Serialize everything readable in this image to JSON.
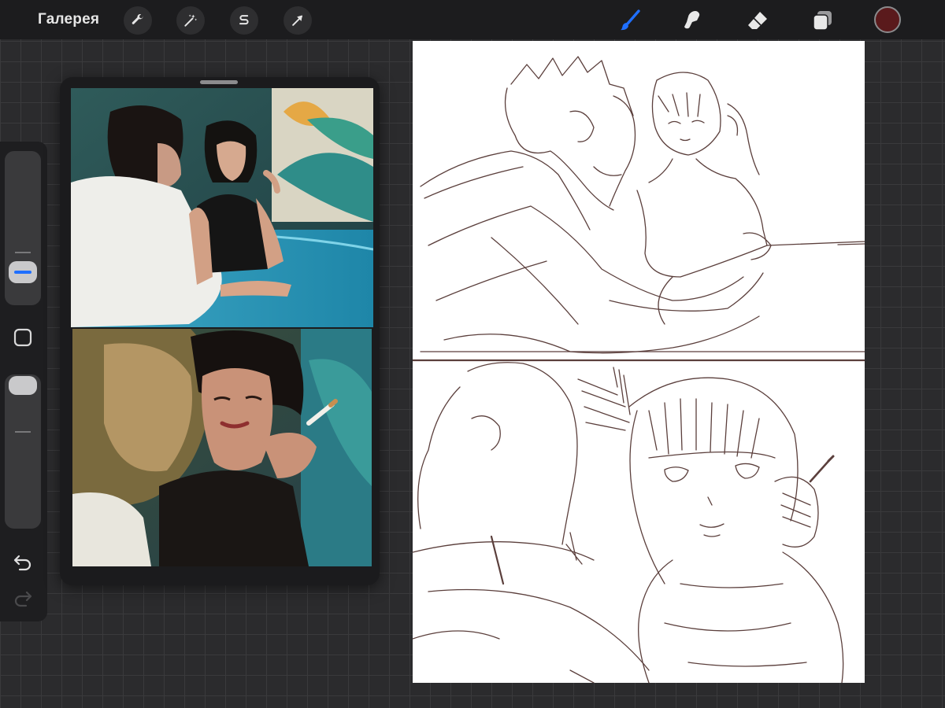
{
  "toolbar": {
    "gallery_label": "Галерея",
    "left_tools": [
      {
        "name": "actions",
        "icon": "wrench-icon"
      },
      {
        "name": "adjustments",
        "icon": "magic-wand-icon"
      },
      {
        "name": "selection",
        "icon": "selection-s-icon"
      },
      {
        "name": "transform",
        "icon": "arrow-cursor-icon"
      }
    ],
    "right_tools": [
      {
        "name": "brush",
        "icon": "brush-icon",
        "active": true
      },
      {
        "name": "smudge",
        "icon": "smudge-icon",
        "active": false
      },
      {
        "name": "eraser",
        "icon": "eraser-icon",
        "active": false
      },
      {
        "name": "layers",
        "icon": "layers-icon",
        "active": false
      }
    ],
    "current_color": "#5a1a1c",
    "active_color": "#1f6fff",
    "inactive_color": "#e8e8e8"
  },
  "sidebar": {
    "size_slider": {
      "icon": "size-slider"
    },
    "modify_button": {
      "icon": "square-modify-icon"
    },
    "opacity_slider": {
      "icon": "opacity-slider",
      "level": 1.0
    },
    "undo": {
      "icon": "undo-icon",
      "enabled": true
    },
    "redo": {
      "icon": "redo-icon",
      "enabled": false
    }
  },
  "reference_window": {
    "photos": [
      {
        "icon": "reference-photo-couple-at-table"
      },
      {
        "icon": "reference-photo-closeup-woman-with-cigarette"
      }
    ]
  },
  "canvas": {
    "background": "#ffffff",
    "sketch_color": "#5b3f3c",
    "panels": [
      {
        "icon": "sketch-panel-couple-at-table"
      },
      {
        "icon": "sketch-panel-closeup-girl-with-cigarette"
      }
    ]
  }
}
